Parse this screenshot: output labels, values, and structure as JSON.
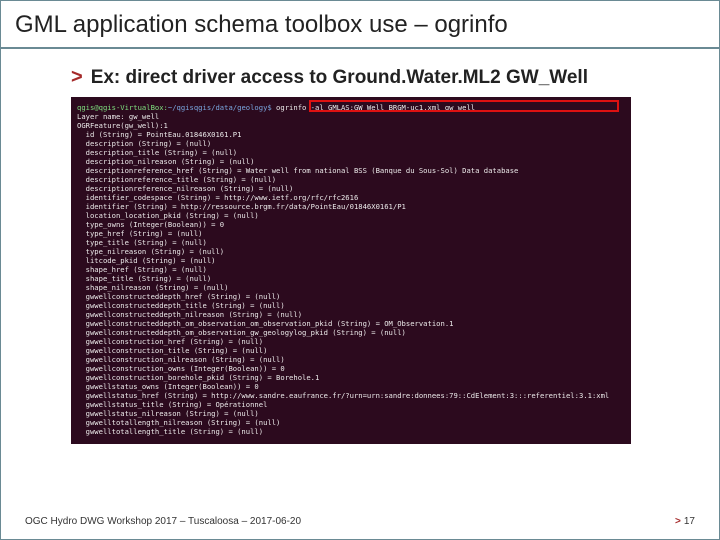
{
  "title": "GML application schema toolbox use – ogrinfo",
  "bullet_chevron": ">",
  "bullet": "Ex: direct driver access to Ground.Water.ML2 GW_Well",
  "terminal": {
    "prompt_user": "qgis@qgis-VirtualBox:",
    "prompt_path": "~/qgisqgis/data/geology$",
    "prompt_cmd": " ogrinfo -al GMLAS:GW_Well_BRGM-uc1.xml gw_well",
    "lines": [
      "Layer name: gw_well",
      "OGRFeature(gw_well):1",
      "  id (String) = PointEau.01846X0161.P1",
      "  description (String) = (null)",
      "  description_title (String) = (null)",
      "  description_nilreason (String) = (null)",
      "  descriptionreference_href (String) = Water well from national BSS (Banque du Sous-Sol) Data database",
      "  descriptionreference_title (String) = (null)",
      "  descriptionreference_nilreason (String) = (null)",
      "  identifier_codespace (String) = http://www.ietf.org/rfc/rfc2616",
      "  identifier (String) = http://ressource.brgm.fr/data/PointEau/01846X0161/P1",
      "  location_location_pkid (String) = (null)",
      "  type_owns (Integer(Boolean)) = 0",
      "  type_href (String) = (null)",
      "  type_title (String) = (null)",
      "  type_nilreason (String) = (null)",
      "  litcode_pkid (String) = (null)",
      "  shape_href (String) = (null)",
      "  shape_title (String) = (null)",
      "  shape_nilreason (String) = (null)",
      "  gwwellconstructeddepth_href (String) = (null)",
      "  gwwellconstructeddepth_title (String) = (null)",
      "  gwwellconstructeddepth_nilreason (String) = (null)",
      "  gwwellconstructeddepth_om_observation_om_observation_pkid (String) = OM_Observation.1",
      "  gwwellconstructeddepth_om_observation_gw_geologylog_pkid (String) = (null)",
      "  gwwellconstruction_href (String) = (null)",
      "  gwwellconstruction_title (String) = (null)",
      "  gwwellconstruction_nilreason (String) = (null)",
      "  gwwellconstruction_owns (Integer(Boolean)) = 0",
      "  gwwellconstruction_borehole_pkid (String) = Borehole.1",
      "  gwwellstatus_owns (Integer(Boolean)) = 0",
      "  gwwellstatus_href (String) = http://www.sandre.eaufrance.fr/?urn=urn:sandre:donnees:79::CdElement:3:::referentiel:3.1:xml",
      "  gwwellstatus_title (String) = Opérationnel",
      "  gwwellstatus_nilreason (String) = (null)",
      "  gwwelltotallength_nilreason (String) = (null)",
      "  gwwelltotallength_title (String) = (null)"
    ]
  },
  "footer_left": "OGC Hydro DWG Workshop 2017 –  Tuscaloosa – 2017-06-20",
  "footer_page_chev": ">",
  "footer_page_num": "17"
}
